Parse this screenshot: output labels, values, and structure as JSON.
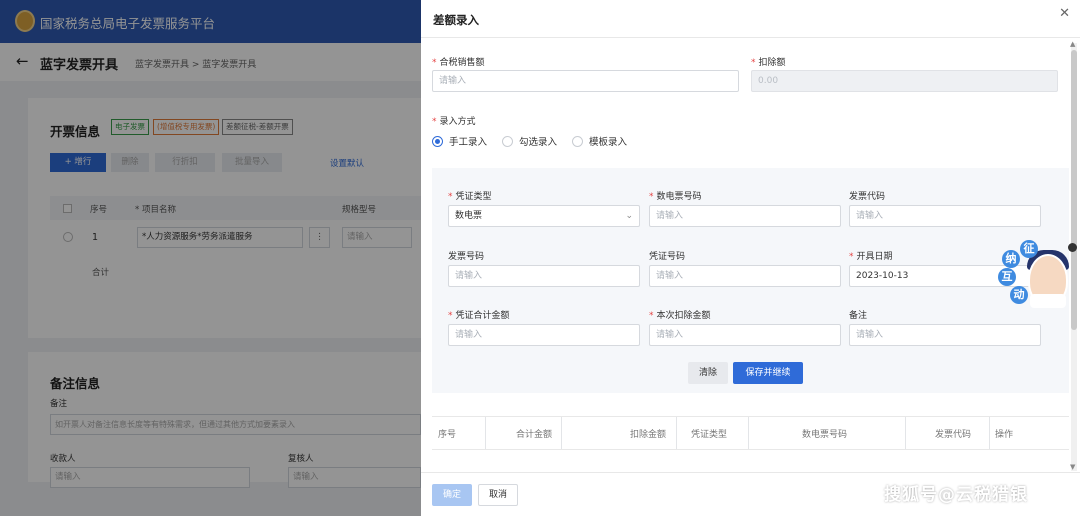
{
  "app": {
    "title": "国家税务总局电子发票服务平台"
  },
  "page": {
    "back_icon": "arrow-left-icon",
    "title": "蓝字发票开具",
    "breadcrumb": "蓝字发票开具 > 蓝字发票开具"
  },
  "invoice_section": {
    "title": "开票信息",
    "tags": [
      "电子发票",
      "(增值税专用发票)",
      "差额征税-差额开票"
    ],
    "buttons": {
      "add": "+ 增行",
      "delete": "删除",
      "b3": "行折扣",
      "b4": "批量导入"
    },
    "set_default_link": "设置默认",
    "table": {
      "headers": [
        "序号",
        "* 项目名称",
        "规格型号"
      ],
      "row": {
        "index": "1",
        "name": "*人力资源服务*劳务派遣服务",
        "more": "⋮",
        "spec_placeholder": "请输入"
      },
      "total_label": "合计"
    }
  },
  "remarks_section": {
    "title": "备注信息",
    "remark_label": "备注",
    "remark_placeholder": "如开票人对备注信息长度等有特殊需求，但通过其他方式加要素录入",
    "payee_label": "收款人",
    "payee_placeholder": "请输入",
    "reviewer_label": "复核人",
    "reviewer_placeholder": "请输入"
  },
  "drawer": {
    "title": "差额录入",
    "close_icon": "close-icon",
    "tax_sales_label": "合税销售额",
    "tax_sales_placeholder": "请输入",
    "deduction_label": "扣除额",
    "deduction_value": "0.00",
    "entry_mode_label": "录入方式",
    "entry_modes": [
      "手工录入",
      "勾选录入",
      "模板录入"
    ],
    "selected_mode": "手工录入",
    "form": {
      "voucher_type_label": "凭证类型",
      "voucher_type_value": "数电票",
      "digital_no_label": "数电票号码",
      "digital_no_placeholder": "请输入",
      "invoice_code_label": "发票代码",
      "invoice_code_placeholder": "请输入",
      "invoice_no_label": "发票号码",
      "invoice_no_placeholder": "请输入",
      "voucher_no_label": "凭证号码",
      "voucher_no_placeholder": "请输入",
      "issue_date_label": "开具日期",
      "issue_date_value": "2023-10-13",
      "voucher_total_label": "凭证合计金额",
      "voucher_total_placeholder": "请输入",
      "this_deduction_label": "本次扣除金额",
      "this_deduction_placeholder": "请输入",
      "remark_label": "备注",
      "remark_placeholder": "请输入"
    },
    "clear_button": "清除",
    "save_continue_button": "保存并继续",
    "table_headers": [
      "序号",
      "合计金额",
      "扣除金额",
      "凭证类型",
      "数电票号码",
      "发票代码",
      "操作"
    ],
    "confirm_button": "确定",
    "cancel_button": "取消"
  },
  "mascot": {
    "chars": [
      "征",
      "纳",
      "互",
      "动"
    ]
  },
  "watermark": "搜狐号@云税猎银",
  "colors": {
    "primary": "#2f6bd8",
    "header": "#2f5bb3",
    "required": "#e54545"
  }
}
